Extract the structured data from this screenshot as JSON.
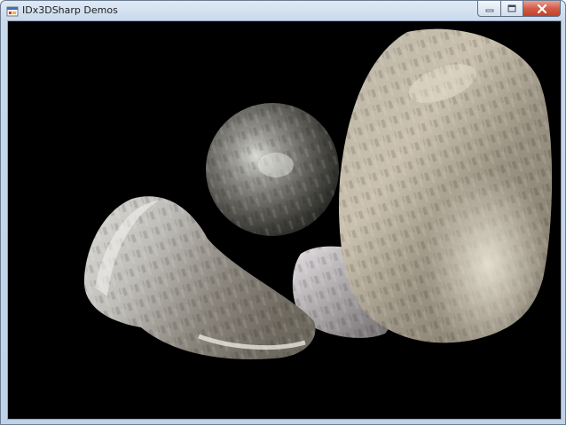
{
  "window": {
    "title": "IDx3DSharp Demos",
    "icons": {
      "app": "application-icon",
      "minimize": "minimize-icon",
      "maximize": "maximize-icon",
      "close": "close-icon"
    }
  },
  "viewport": {
    "background": "#000000",
    "objects": [
      "textured-sphere",
      "large-textured-egg",
      "small-textured-blob",
      "elongated-textured-pear"
    ]
  }
}
